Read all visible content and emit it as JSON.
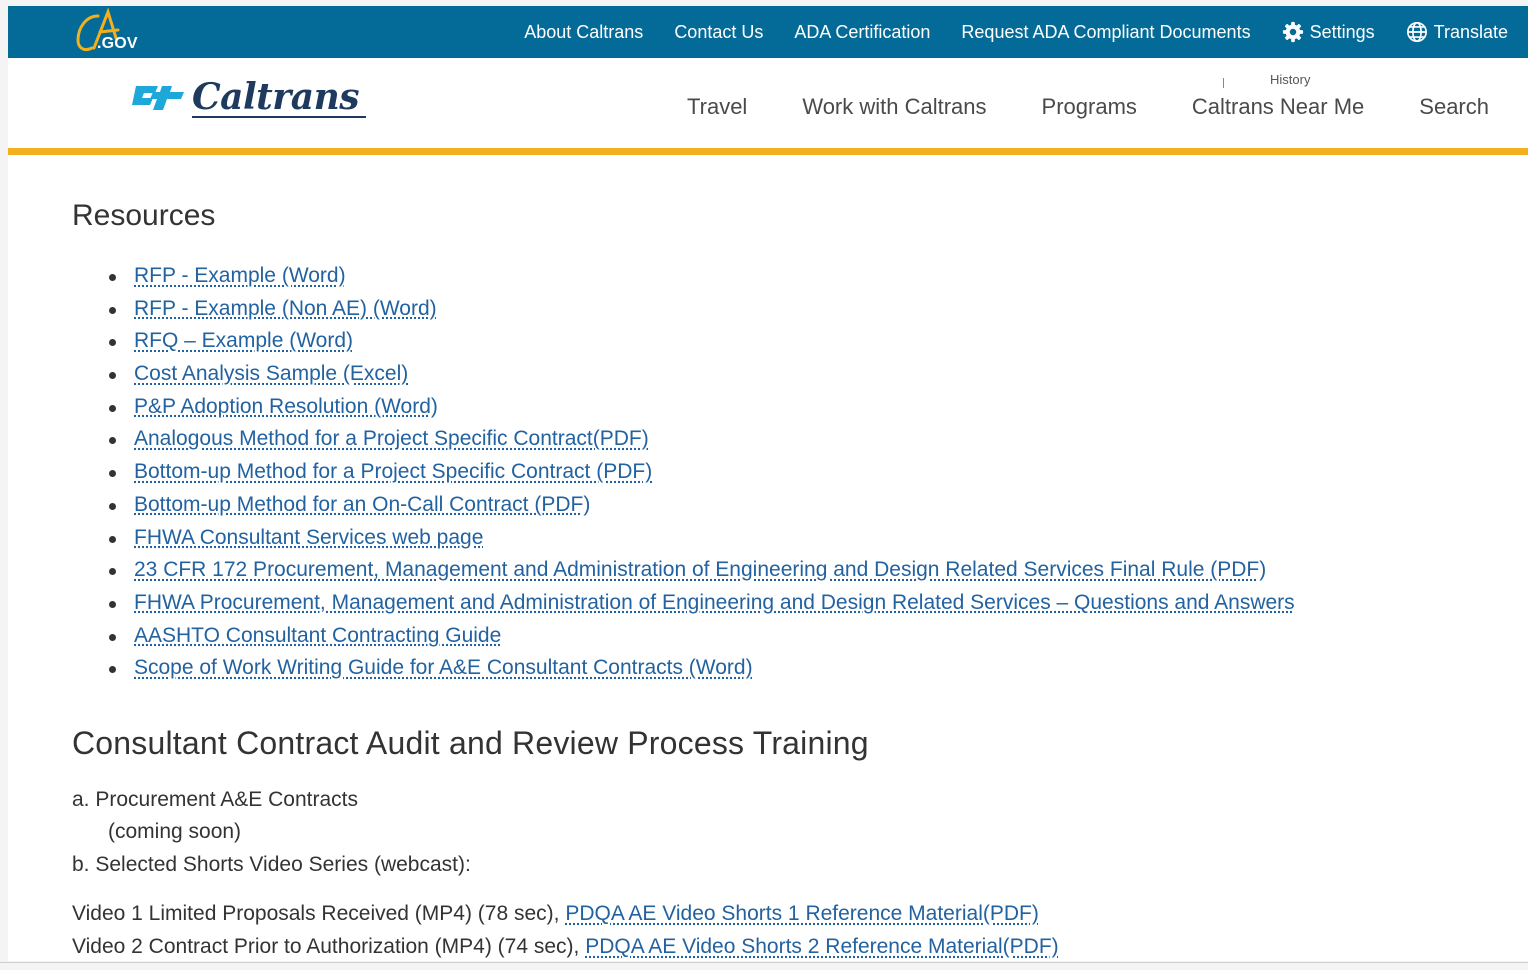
{
  "utility_bar": {
    "logo": {
      "top_text": "CA",
      "bottom_text": ".GOV"
    },
    "links": [
      {
        "label": "About Caltrans"
      },
      {
        "label": "Contact Us"
      },
      {
        "label": "ADA Certification"
      },
      {
        "label": "Request ADA Compliant Documents"
      },
      {
        "label": "Settings",
        "icon": "gear-icon"
      },
      {
        "label": "Translate",
        "icon": "globe-icon"
      }
    ]
  },
  "header": {
    "brand": "Caltrans",
    "history_fragment": "History",
    "nav": [
      "Travel",
      "Work with Caltrans",
      "Programs",
      "Caltrans Near Me",
      "Search"
    ]
  },
  "colors": {
    "utility_bg": "#046b99",
    "gold": "#f2b01e",
    "link": "#2262a0",
    "brand_blue": "#1e3a5f",
    "logo_cyan": "#1ea7d9"
  },
  "resources": {
    "heading": "Resources",
    "items": [
      "RFP - Example (Word)",
      "RFP - Example (Non AE) (Word)",
      "RFQ – Example (Word)",
      "Cost Analysis Sample (Excel)",
      "P&P Adoption Resolution (Word)",
      "Analogous Method for a Project Specific Contract(PDF)",
      "Bottom-up Method for a Project Specific Contract (PDF)",
      "Bottom-up Method for an On-Call Contract (PDF)",
      "FHWA Consultant Services web page",
      "23 CFR 172 Procurement, Management and Administration of Engineering and Design Related Services Final Rule (PDF)",
      "FHWA Procurement, Management and Administration of Engineering and Design Related Services – Questions and Answers",
      "AASHTO Consultant Contracting Guide",
      "Scope of Work Writing Guide for A&E Consultant Contracts (Word)"
    ]
  },
  "training": {
    "heading": "Consultant Contract Audit and Review Process Training",
    "item_a": "a. Procurement A&E Contracts",
    "item_a_note": "(coming soon)",
    "item_b": "b. Selected Shorts Video Series (webcast):",
    "videos": [
      {
        "text": "Video 1 Limited Proposals Received (MP4) (78 sec),",
        "link": "PDQA AE Video Shorts 1 Reference Material(PDF)"
      },
      {
        "text": "Video 2 Contract Prior to Authorization (MP4) (74 sec),",
        "link": "PDQA AE Video Shorts 2 Reference Material(PDF)"
      }
    ]
  }
}
